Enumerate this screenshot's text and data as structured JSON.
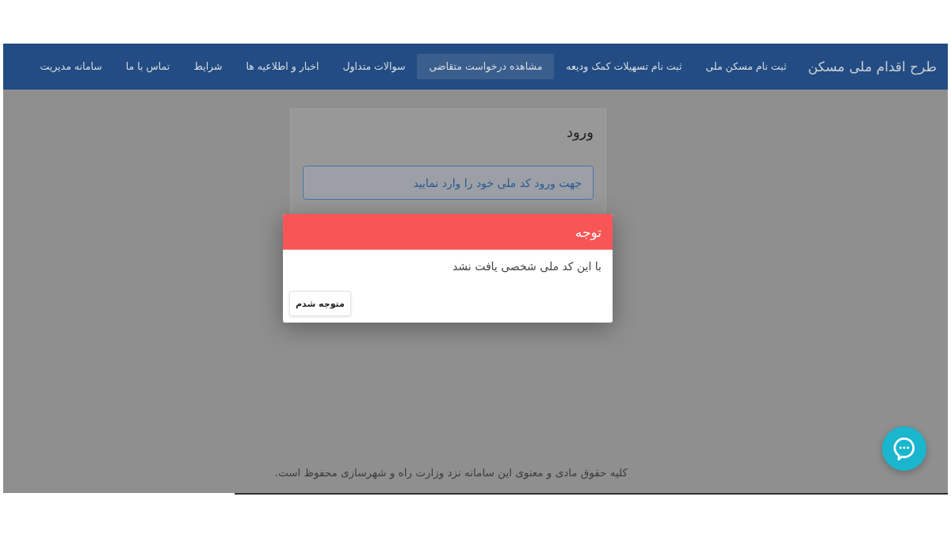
{
  "navbar": {
    "title": "طرح اقدام ملی مسکن",
    "items": [
      {
        "label": "ثبت نام مسکن ملی",
        "selected": false
      },
      {
        "label": "ثبت نام تسهیلات کمک ودیعه",
        "selected": false
      },
      {
        "label": "مشاهده درخواست متقاضی",
        "selected": true
      },
      {
        "label": "سوالات متداول",
        "selected": false
      },
      {
        "label": "اخبار و اطلاعیه ها",
        "selected": false
      },
      {
        "label": "شرایط",
        "selected": false
      },
      {
        "label": "تماس با ما",
        "selected": false
      },
      {
        "label": "سامانه مدیریت",
        "selected": false
      }
    ]
  },
  "login_card": {
    "title": "ورود",
    "national_id_field": {
      "placeholder": "جهت ورود کد ملی خود را وارد نمایید"
    }
  },
  "alert_dialog": {
    "title": "توجه",
    "message": "با این کد ملی شخصی یافت نشد",
    "buttons": [
      "متوجه شدم"
    ]
  },
  "footer": {
    "text": "کلیه حقوق مادی و معنوی این سامانه نزد وزارت راه و شهرسازی محفوظ است."
  }
}
